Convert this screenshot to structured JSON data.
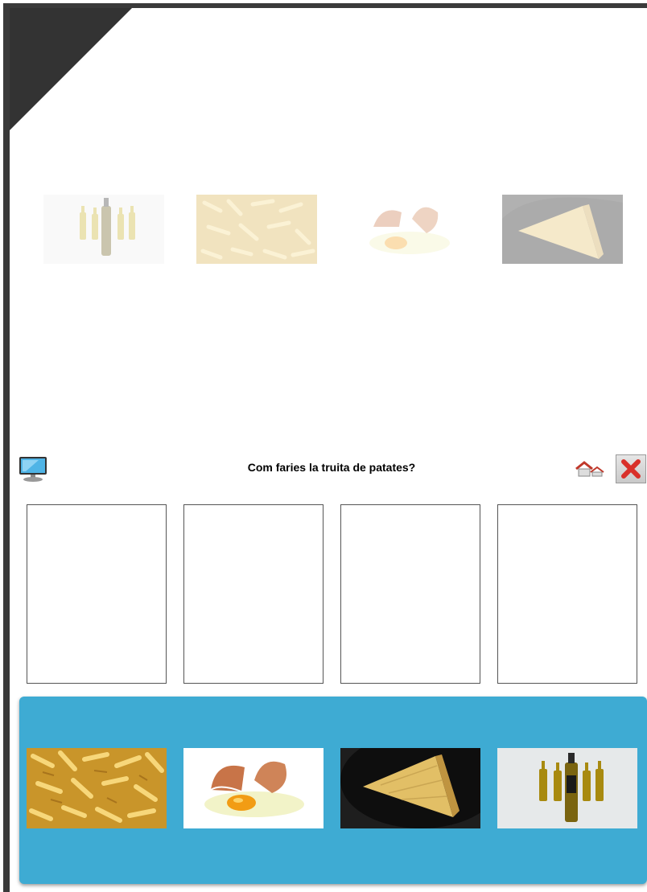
{
  "question": "Com faries la truita de patates?",
  "background_images": [
    {
      "name": "oil-bottles"
    },
    {
      "name": "fried-potatoes"
    },
    {
      "name": "cracked-egg"
    },
    {
      "name": "potato-omelette"
    }
  ],
  "drop_slots": [
    {
      "content": ""
    },
    {
      "content": ""
    },
    {
      "content": ""
    },
    {
      "content": ""
    }
  ],
  "tray_cards": [
    {
      "name": "fried-potatoes"
    },
    {
      "name": "cracked-egg"
    },
    {
      "name": "potato-omelette"
    },
    {
      "name": "oil-bottles"
    }
  ],
  "icons": {
    "left": "monitor-icon",
    "home": "home-icon",
    "close": "close-icon"
  },
  "colors": {
    "tray": "#3eabd3",
    "frame": "#3a3a3a",
    "close_x": "#d9302a"
  }
}
